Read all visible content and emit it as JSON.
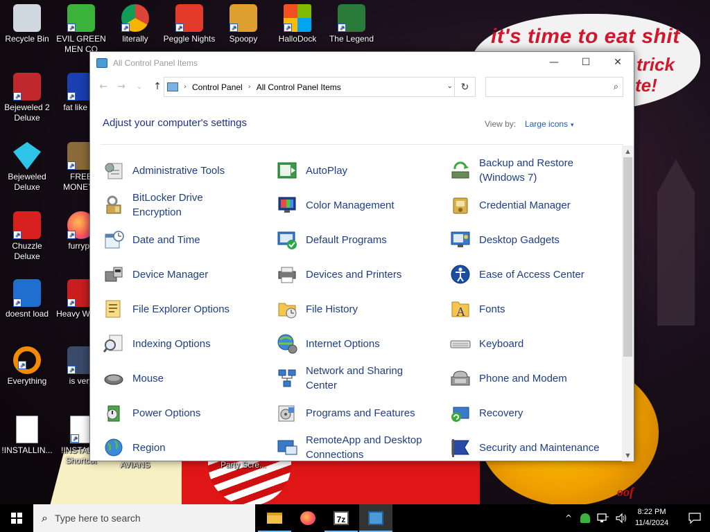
{
  "wallpaper": {
    "caption_line1": "it's time to eat shit",
    "caption_line2a": "trick",
    "caption_line2b": "te!",
    "pumpkin_text": "oof"
  },
  "desktop_icons": [
    {
      "label": "Recycle Bin",
      "icon": "recycle-bin-icon",
      "color": "#cfd8e0",
      "shortcut": false
    },
    {
      "label": "EVIL GREEN MEN CO",
      "icon": "green-men-icon",
      "color": "#3bb33b",
      "shortcut": true
    },
    {
      "label": "literally",
      "icon": "chrome-icon",
      "color": "#db4437",
      "shortcut": true
    },
    {
      "label": "Peggle Nights",
      "icon": "peggle-icon",
      "color": "#e23b2b",
      "shortcut": true
    },
    {
      "label": "Spoopy",
      "icon": "folder-icon",
      "color": "#e0a030",
      "shortcut": true
    },
    {
      "label": "HalloDock",
      "icon": "windows-logo-icon",
      "color": "#f25022",
      "shortcut": true
    },
    {
      "label": "The Legend",
      "icon": "legend-icon",
      "color": "#2a7a3a",
      "shortcut": true
    },
    {
      "label": "Bejeweled 2 Deluxe",
      "icon": "bejeweled2-icon",
      "color": "#c0282d",
      "shortcut": true
    },
    {
      "label": "fat like da",
      "icon": "mp-icon",
      "color": "#1a3fb0",
      "shortcut": true
    },
    {
      "label": "Bejeweled Deluxe",
      "icon": "gem-icon",
      "color": "#2ec4e8",
      "shortcut": true
    },
    {
      "label": "FREE MONEY.c",
      "icon": "money-bag-icon",
      "color": "#8a6a3a",
      "shortcut": true
    },
    {
      "label": "Chuzzle Deluxe",
      "icon": "chuzzle-icon",
      "color": "#d92020",
      "shortcut": true
    },
    {
      "label": "furrypo",
      "icon": "firefox-icon",
      "color": "#ff7a1a",
      "shortcut": true
    },
    {
      "label": "doesnt load",
      "icon": "thunderbird-icon",
      "color": "#1f6fd1",
      "shortcut": true
    },
    {
      "label": "Heavy Weap.",
      "icon": "radiation-icon",
      "color": "#c81e1e",
      "shortcut": true
    },
    {
      "label": "Everything",
      "icon": "search-ring-icon",
      "color": "#f28b00",
      "shortcut": true
    },
    {
      "label": "is very",
      "icon": "badge-icon",
      "color": "#3a4a6a",
      "shortcut": true
    },
    {
      "label": "!INSTALLIN...",
      "icon": "text-file-icon",
      "color": "#ffffff",
      "shortcut": false
    },
    {
      "label": "!INSTALL - Shortcut",
      "icon": "text-file-icon",
      "color": "#ffffff",
      "shortcut": true
    },
    {
      "label": "AVIANS",
      "icon": "",
      "color": "",
      "shortcut": false
    },
    {
      "label": "Party Scre...",
      "icon": "",
      "color": "",
      "shortcut": false
    }
  ],
  "window": {
    "title": "All Control Panel Items",
    "buttons": {
      "minimize": "—",
      "maximize": "☐",
      "close": "✕"
    },
    "nav": {
      "back": "←",
      "forward": "→",
      "dropdown": "⌄",
      "up": "↑"
    },
    "address": {
      "crumbs": [
        "Control Panel",
        "All Control Panel Items"
      ],
      "sep": "›",
      "dropdown": "⌄",
      "refresh": "↻"
    },
    "search": {
      "placeholder": "",
      "icon": "⌕"
    },
    "heading": "Adjust your computer's settings",
    "view_by_label": "View by:",
    "view_by_value": "Large icons",
    "view_caret": "▾",
    "scroll": {
      "up": "▲",
      "down": "▼"
    },
    "items": [
      {
        "label": "Administrative Tools",
        "icon": "administrative-tools-icon"
      },
      {
        "label": "AutoPlay",
        "icon": "autoplay-icon"
      },
      {
        "label": "Backup and Restore (Windows 7)",
        "icon": "backup-restore-icon"
      },
      {
        "label": "BitLocker Drive Encryption",
        "icon": "bitlocker-icon"
      },
      {
        "label": "Color Management",
        "icon": "color-management-icon"
      },
      {
        "label": "Credential Manager",
        "icon": "credential-manager-icon"
      },
      {
        "label": "Date and Time",
        "icon": "date-time-icon"
      },
      {
        "label": "Default Programs",
        "icon": "default-programs-icon"
      },
      {
        "label": "Desktop Gadgets",
        "icon": "desktop-gadgets-icon"
      },
      {
        "label": "Device Manager",
        "icon": "device-manager-icon"
      },
      {
        "label": "Devices and Printers",
        "icon": "devices-printers-icon"
      },
      {
        "label": "Ease of Access Center",
        "icon": "ease-of-access-icon"
      },
      {
        "label": "File Explorer Options",
        "icon": "file-explorer-options-icon"
      },
      {
        "label": "File History",
        "icon": "file-history-icon"
      },
      {
        "label": "Fonts",
        "icon": "fonts-icon"
      },
      {
        "label": "Indexing Options",
        "icon": "indexing-options-icon"
      },
      {
        "label": "Internet Options",
        "icon": "internet-options-icon"
      },
      {
        "label": "Keyboard",
        "icon": "keyboard-icon"
      },
      {
        "label": "Mouse",
        "icon": "mouse-icon"
      },
      {
        "label": "Network and Sharing Center",
        "icon": "network-sharing-icon"
      },
      {
        "label": "Phone and Modem",
        "icon": "phone-modem-icon"
      },
      {
        "label": "Power Options",
        "icon": "power-options-icon"
      },
      {
        "label": "Programs and Features",
        "icon": "programs-features-icon"
      },
      {
        "label": "Recovery",
        "icon": "recovery-icon"
      },
      {
        "label": "Region",
        "icon": "region-icon"
      },
      {
        "label": "RemoteApp and Desktop Connections",
        "icon": "remoteapp-icon"
      },
      {
        "label": "Security and Maintenance",
        "icon": "security-maintenance-icon"
      }
    ]
  },
  "taskbar": {
    "search_placeholder": "Type here to search",
    "search_icon": "⌕",
    "apps": [
      {
        "name": "file-explorer",
        "icon": "file-explorer-icon",
        "color": "#f5c04a"
      },
      {
        "name": "firefox",
        "icon": "firefox-icon",
        "color": "#ff7a1a"
      },
      {
        "name": "7zip",
        "icon": "7zip-icon",
        "color": "#ffffff",
        "text": "7z"
      },
      {
        "name": "control-panel",
        "icon": "control-panel-icon",
        "color": "#4a9ad6",
        "active": true
      }
    ],
    "tray": {
      "chevron": "^",
      "time": "8:22 PM",
      "date": "11/4/2024",
      "notification": "🗨"
    }
  },
  "colors": {
    "link": "#1e3e85",
    "heading": "#1e3287",
    "accent": "#1a5fb4",
    "taskbar": "#000000"
  }
}
